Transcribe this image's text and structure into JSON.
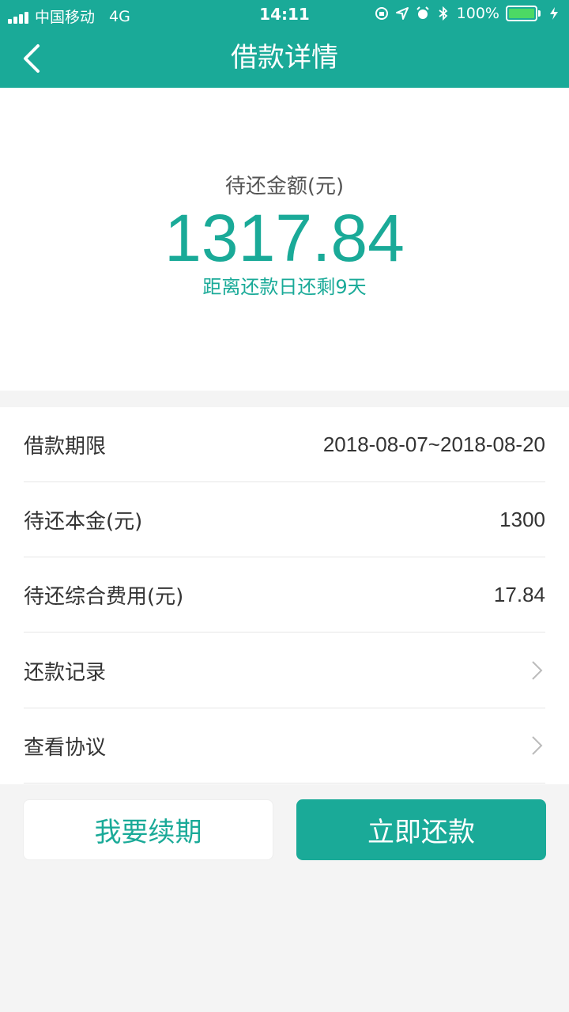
{
  "status_bar": {
    "carrier": "中国移动",
    "network": "4G",
    "time": "14:11",
    "battery": "100%",
    "icons": [
      "orientation-lock-icon",
      "location-icon",
      "alarm-icon",
      "bluetooth-icon",
      "battery-icon",
      "charging-icon"
    ]
  },
  "nav": {
    "title": "借款详情",
    "back_icon": "back-arrow-icon"
  },
  "summary": {
    "label": "待还金额(元)",
    "amount": "1317.84",
    "note": "距离还款日还剩9天"
  },
  "details": {
    "rows": [
      {
        "label": "借款期限",
        "value": "2018-08-07~2018-08-20"
      },
      {
        "label": "待还本金(元)",
        "value": "1300"
      },
      {
        "label": "待还综合费用(元)",
        "value": "17.84"
      },
      {
        "label": "还款记录",
        "icon": "chevron-right-icon"
      },
      {
        "label": "查看协议",
        "icon": "chevron-right-icon"
      }
    ]
  },
  "actions": {
    "renew_label": "我要续期",
    "repay_label": "立即还款"
  },
  "colors": {
    "brand": "#1aaa98",
    "background": "#f4f4f4",
    "battery": "#4cd964"
  }
}
